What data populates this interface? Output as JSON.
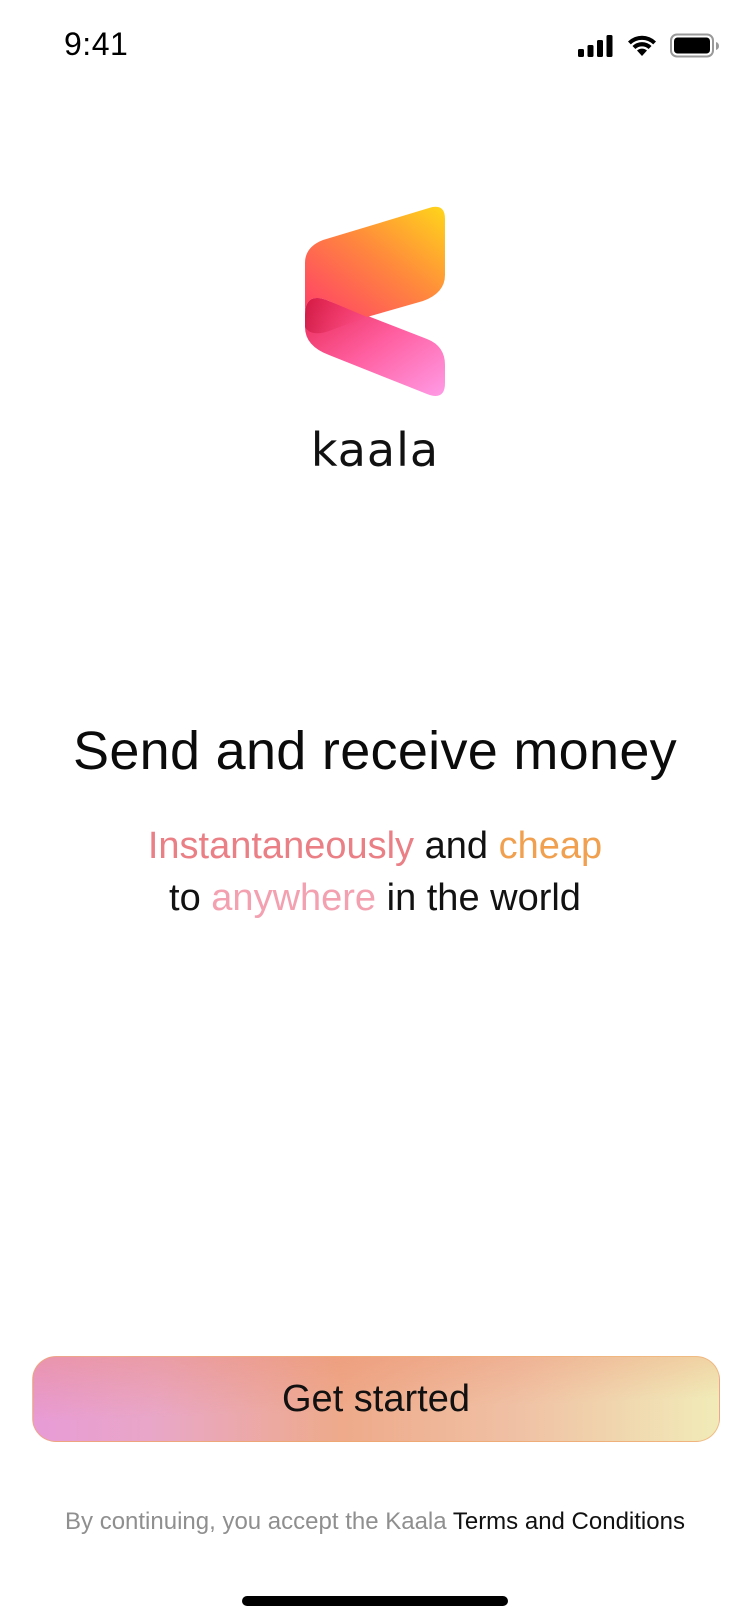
{
  "status_bar": {
    "time": "9:41",
    "icons": [
      "cellular-signal-icon",
      "wifi-icon",
      "battery-icon"
    ]
  },
  "brand": {
    "wordmark": "kaala",
    "logo_icon": "kaala-logo-icon",
    "gradient_colors": [
      "#ff3d6e",
      "#ff7a3d",
      "#ffd21a",
      "#ff94e0"
    ]
  },
  "hero": {
    "headline": "Send and receive money",
    "subline": {
      "instantaneously": "Instantaneously",
      "and": " and ",
      "cheap": "cheap",
      "to": "to ",
      "anywhere": "anywhere",
      "in_the_world": " in the world"
    },
    "accent_colors": {
      "instantaneously": "#ea7f86",
      "cheap": "#f0a04f",
      "anywhere": "#f3a1b1"
    }
  },
  "cta": {
    "label": "Get started"
  },
  "terms": {
    "prefix": "By continuing, you accept the Kaala ",
    "link": "Terms and Conditions"
  }
}
